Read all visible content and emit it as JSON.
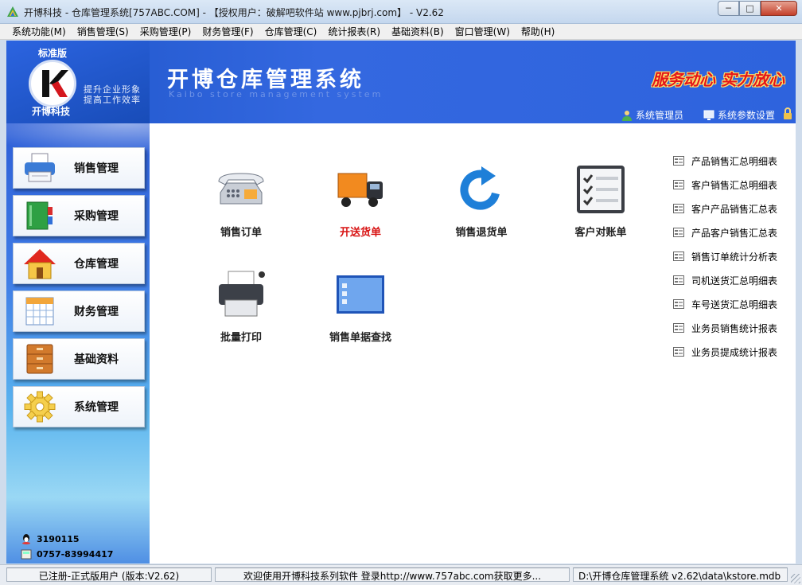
{
  "window": {
    "title": "开博科技 - 仓库管理系统[757ABC.COM] - 【授权用户：破解吧软件站 www.pjbrj.com】 - V2.62",
    "minimize": "─",
    "maximize": "□",
    "close": "✕"
  },
  "menu": [
    "系统功能(M)",
    "销售管理(S)",
    "采购管理(P)",
    "财务管理(F)",
    "仓库管理(C)",
    "统计报表(R)",
    "基础资料(B)",
    "窗口管理(W)",
    "帮助(H)"
  ],
  "header": {
    "edition": "标准版",
    "company": "开博科技",
    "slogan_line1": "提升企业形象",
    "slogan_line2": "提高工作效率",
    "title": "开博仓库管理系统",
    "subtitle": "Kaibo store management system",
    "motto": "服务动心  实力放心",
    "admin_label": "系统管理员",
    "settings_label": "系统参数设置"
  },
  "sidebar": {
    "items": [
      {
        "label": "销售管理",
        "icon": "printer-icon"
      },
      {
        "label": "采购管理",
        "icon": "books-icon"
      },
      {
        "label": "仓库管理",
        "icon": "house-icon"
      },
      {
        "label": "财务管理",
        "icon": "calendar-icon"
      },
      {
        "label": "基础资料",
        "icon": "cabinet-icon"
      },
      {
        "label": "系统管理",
        "icon": "gear-icon"
      }
    ],
    "qq": "3190115",
    "phone": "0757-83994417"
  },
  "tiles": [
    {
      "label": "销售订单",
      "icon": "telephone-icon"
    },
    {
      "label": "开送货单",
      "icon": "truck-icon",
      "active": true
    },
    {
      "label": "销售退货单",
      "icon": "refresh-icon"
    },
    {
      "label": "客户对账单",
      "icon": "checklist-icon"
    },
    {
      "label": "批量打印",
      "icon": "printer-icon"
    },
    {
      "label": "销售单据查找",
      "icon": "window-list-icon"
    }
  ],
  "reports": [
    "产品销售汇总明细表",
    "客户销售汇总明细表",
    "客户产品销售汇总表",
    "产品客户销售汇总表",
    "销售订单统计分析表",
    "司机送货汇总明细表",
    "车号送货汇总明细表",
    "业务员销售统计报表",
    "业务员提成统计报表"
  ],
  "status": {
    "registration": "已注册-正式版用户 (版本:V2.62)",
    "welcome": "欢迎使用开博科技系列软件  登录http://www.757abc.com获取更多...",
    "db_path": "D:\\开博仓库管理系统 v2.62\\data\\kstore.mdb"
  },
  "colors": {
    "header_blue": "#2e63dd",
    "active_tile": "#d81414",
    "motto_red": "#e3161b"
  }
}
